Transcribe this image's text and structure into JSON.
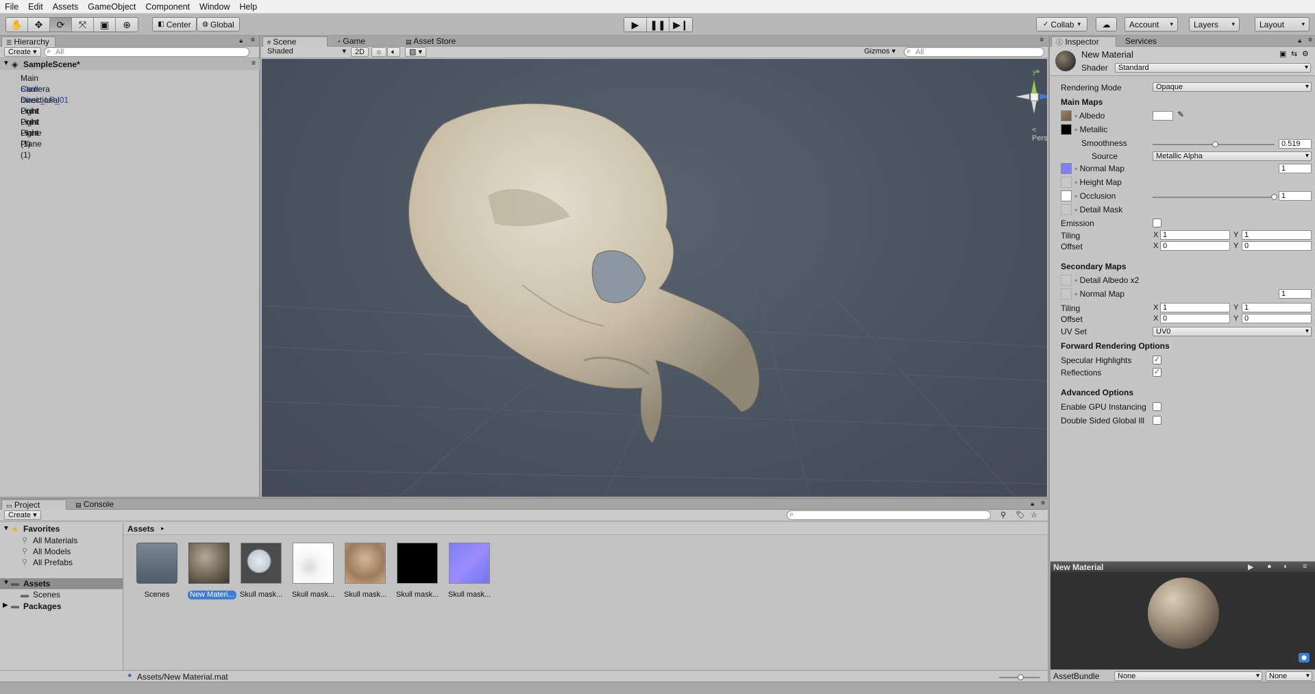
{
  "menu": [
    "File",
    "Edit",
    "Assets",
    "GameObject",
    "Component",
    "Window",
    "Help"
  ],
  "toolbar": {
    "pivot": "Center",
    "space": "Global",
    "collab": "Collab",
    "account": "Account",
    "layers": "Layers",
    "layout": "Layout"
  },
  "hierarchy": {
    "tab": "Hierarchy",
    "create": "Create",
    "search_placeholder": "All",
    "scene": "SampleScene*",
    "items": [
      "Main Camera",
      "Skull mask_LP_01",
      "Directional Light",
      "Point Light",
      "Point Light (1)",
      "Plane",
      "Plane (1)"
    ],
    "selected_index": 1
  },
  "scene": {
    "tabs": [
      "Scene",
      "Game",
      "Asset Store"
    ],
    "shading": "Shaded",
    "mode_2d": "2D",
    "gizmos": "Gizmos",
    "search_placeholder": "All",
    "persp": "Persp",
    "axis_y": "y",
    "axis_z": "z"
  },
  "inspector": {
    "tabs": [
      "Inspector",
      "Services"
    ],
    "material_name": "New Material",
    "shader_label": "Shader",
    "shader": "Standard",
    "rendering_mode_label": "Rendering Mode",
    "rendering_mode": "Opaque",
    "main_maps": "Main Maps",
    "albedo": "Albedo",
    "metallic": "Metallic",
    "smoothness": "Smoothness",
    "smoothness_value": "0.519",
    "source": "Source",
    "source_value": "Metallic Alpha",
    "normal_map": "Normal Map",
    "normal_map_value": "1",
    "height_map": "Height Map",
    "occlusion": "Occlusion",
    "occlusion_value": "1",
    "detail_mask": "Detail Mask",
    "emission": "Emission",
    "tiling": "Tiling",
    "offset": "Offset",
    "x": "X",
    "y": "Y",
    "tiling_x": "1",
    "tiling_y": "1",
    "offset_x": "0",
    "offset_y": "0",
    "secondary_maps": "Secondary Maps",
    "detail_albedo": "Detail Albedo x2",
    "normal_map2": "Normal Map",
    "normal_map2_value": "1",
    "tiling2_x": "1",
    "tiling2_y": "1",
    "offset2_x": "0",
    "offset2_y": "0",
    "uv_set": "UV Set",
    "uv_set_value": "UV0",
    "forward_options": "Forward Rendering Options",
    "specular_highlights": "Specular Highlights",
    "reflections": "Reflections",
    "advanced_options": "Advanced Options",
    "gpu_instancing": "Enable GPU Instancing",
    "double_sided": "Double Sided Global Ill",
    "preview_title": "New Material",
    "asset_bundle": "AssetBundle",
    "bundle_name": "None",
    "bundle_variant": "None",
    "smoothness_fraction": 0.519,
    "occlusion_fraction": 1.0
  },
  "project": {
    "tabs": [
      "Project",
      "Console"
    ],
    "create": "Create",
    "favorites": "Favorites",
    "favorite_items": [
      "All Materials",
      "All Models",
      "All Prefabs"
    ],
    "assets_root": "Assets",
    "scenes": "Scenes",
    "packages": "Packages",
    "breadcrumb": "Assets",
    "assets": [
      {
        "label": "Scenes",
        "kind": "folder"
      },
      {
        "label": "New Materi...",
        "kind": "material",
        "selected": true
      },
      {
        "label": "Skull mask...",
        "kind": "model"
      },
      {
        "label": "Skull mask...",
        "kind": "texture-white"
      },
      {
        "label": "Skull mask...",
        "kind": "texture-albedo"
      },
      {
        "label": "Skull mask...",
        "kind": "texture-black"
      },
      {
        "label": "Skull mask...",
        "kind": "texture-normal"
      }
    ],
    "status_path": "Assets/New Material.mat"
  },
  "colors": {
    "scene_bg": "#4b5360",
    "selected_blue": "#3d7bd8",
    "normal_map_purple": "#8080ff"
  }
}
